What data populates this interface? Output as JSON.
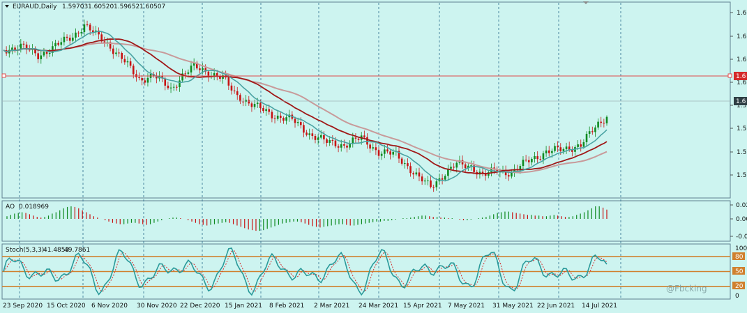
{
  "main": {
    "symbol": "EURAUD,Daily",
    "ohlc": [
      "1.59703",
      "1.60520",
      "1.59652",
      "1.60507"
    ],
    "yticks": [
      "1.6",
      "1.6",
      "1.6",
      "1.6",
      "1.5",
      "1.5",
      "1.5",
      "1.5"
    ],
    "hline_badge": "1.6",
    "price_badge": "1.6",
    "line_colors": {
      "hline": "#e04a4a",
      "ma_fast": "#4aa3a3",
      "ma_mid": "#a01818",
      "ma_slow": "#c89a9a",
      "up": "#0f8a20",
      "down": "#c81212",
      "grid": "#2b6c8c"
    }
  },
  "ao": {
    "label": "AO",
    "value": "0.018969",
    "yticks": [
      "0.02",
      "0.00",
      "-0.0"
    ],
    "bars": [
      0.004,
      0.006,
      0.008,
      0.009,
      0.01,
      0.009,
      0.007,
      0.005,
      0.003,
      0.002,
      0.003,
      0.005,
      0.008,
      0.01,
      0.013,
      0.016,
      0.018,
      0.019,
      0.018,
      0.016,
      0.013,
      0.01,
      0.007,
      0.004,
      0.002,
      0.0,
      -0.002,
      -0.004,
      -0.006,
      -0.007,
      -0.008,
      -0.008,
      -0.007,
      -0.006,
      -0.006,
      -0.007,
      -0.008,
      -0.009,
      -0.008,
      -0.006,
      -0.004,
      -0.002,
      0.0,
      0.001,
      0.002,
      0.002,
      0.001,
      0.0,
      -0.002,
      -0.004,
      -0.006,
      -0.008,
      -0.009,
      -0.01,
      -0.009,
      -0.008,
      -0.007,
      -0.006,
      -0.005,
      -0.006,
      -0.008,
      -0.01,
      -0.012,
      -0.014,
      -0.016,
      -0.017,
      -0.018,
      -0.018,
      -0.017,
      -0.015,
      -0.013,
      -0.011,
      -0.009,
      -0.007,
      -0.006,
      -0.005,
      -0.004,
      -0.004,
      -0.005,
      -0.007,
      -0.009,
      -0.011,
      -0.012,
      -0.013,
      -0.012,
      -0.011,
      -0.01,
      -0.009,
      -0.008,
      -0.008,
      -0.009,
      -0.01,
      -0.01,
      -0.009,
      -0.008,
      -0.007,
      -0.006,
      -0.005,
      -0.004,
      -0.004,
      -0.003,
      -0.003,
      -0.002,
      -0.001,
      0.0,
      0.001,
      0.001,
      0.002,
      0.003,
      0.004,
      0.005,
      0.005,
      0.004,
      0.003,
      0.003,
      0.002,
      0.002,
      0.001,
      0.001,
      0.0,
      -0.001,
      -0.002,
      -0.002,
      -0.001,
      0.0,
      0.001,
      0.002,
      0.003,
      0.005,
      0.007,
      0.009,
      0.01,
      0.011,
      0.011,
      0.01,
      0.009,
      0.008,
      0.007,
      0.006,
      0.006,
      0.005,
      0.005,
      0.004,
      0.004,
      0.005,
      0.006,
      0.005,
      0.004,
      0.003,
      0.003,
      0.004,
      0.006,
      0.008,
      0.01,
      0.013,
      0.016,
      0.019,
      0.019,
      0.017,
      0.014
    ]
  },
  "stoch": {
    "label": "Stoch(5,3,3)",
    "values": [
      "41.4853",
      "49.7861"
    ],
    "yticks": [
      "100",
      "80",
      "50",
      "20",
      "0"
    ],
    "levels": [
      80,
      50,
      20
    ]
  },
  "xaxis": {
    "labels": [
      "23 Sep 2020",
      "15 Oct 2020",
      "6 Nov 2020",
      "30 Nov 2020",
      "22 Dec 2020",
      "15 Jan 2021",
      "8 Feb 2021",
      "2 Mar 2021",
      "24 Mar 2021",
      "15 Apr 2021",
      "7 May 2021",
      "31 May 2021",
      "22 Jun 2021",
      "14 Jul 2021"
    ]
  },
  "watermark": "@Fbcking"
}
